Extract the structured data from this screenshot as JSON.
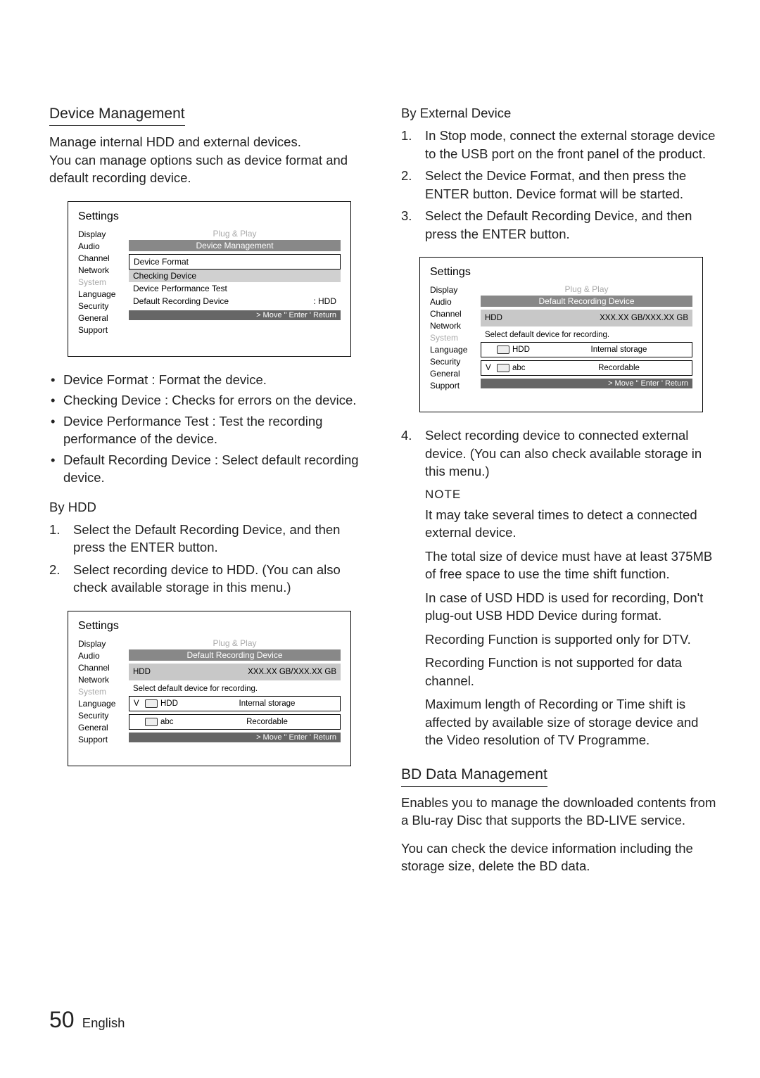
{
  "left": {
    "section_title": "Device Management",
    "intro_p1": "Manage internal HDD and external devices.",
    "intro_p2": "You can manage options such as device format and default recording device.",
    "ui1": {
      "title": "Settings",
      "sidebar": [
        "Display",
        "Audio",
        "Channel",
        "Network",
        "System",
        "Language",
        "Security",
        "General",
        "Support"
      ],
      "plug": "Plug & Play",
      "header": "Device Management",
      "rows": [
        {
          "label": "Device Format",
          "value": "",
          "boxed": true
        },
        {
          "label": "Checking Device",
          "value": "",
          "hi": true
        },
        {
          "label": "Device Performance Test",
          "value": ""
        },
        {
          "label": "Default Recording Device",
          "value": ": HDD"
        }
      ],
      "footer": "> Move    \" Enter    ' Return"
    },
    "bullets": [
      "Device Format : Format the device.",
      "Checking Device : Checks for errors on the device.",
      "Device Performance Test : Test the recording performance of the device.",
      "Default Recording Device : Select default recording device."
    ],
    "by_hdd_heading": "By HDD",
    "by_hdd_steps": [
      "Select the Default Recording Device, and then press the ENTER button.",
      "Select recording device to HDD. (You can also check available storage in this menu.)"
    ],
    "ui2": {
      "title": "Settings",
      "sidebar": [
        "Display",
        "Audio",
        "Channel",
        "Network",
        "System",
        "Language",
        "Security",
        "General",
        "Support"
      ],
      "plug": "Plug & Play",
      "header": "Default Recording Device",
      "hdd_label": "HDD",
      "hdd_value": "XXX.XX GB/XXX.XX GB",
      "select_text": "Select default device for recording.",
      "choice1_pre": "V",
      "choice1_label": "HDD",
      "choice1_value": "Internal storage",
      "choice2_pre": "",
      "choice2_label": "abc",
      "choice2_value": "Recordable",
      "footer": "> Move    \" Enter    ' Return"
    }
  },
  "right": {
    "by_ext_heading": "By External Device",
    "by_ext_steps": [
      "In Stop mode, connect the external storage device to the USB port on the front panel of the product.",
      "Select the Device Format, and then press the ENTER button. Device format will be started.",
      "Select the Default Recording Device, and then press the ENTER button."
    ],
    "ui3": {
      "title": "Settings",
      "sidebar": [
        "Display",
        "Audio",
        "Channel",
        "Network",
        "System",
        "Language",
        "Security",
        "General",
        "Support"
      ],
      "plug": "Plug & Play",
      "header": "Default Recording Device",
      "hdd_label": "HDD",
      "hdd_value": "XXX.XX GB/XXX.XX GB",
      "select_text": "Select default device for recording.",
      "choice1_pre": "",
      "choice1_label": "HDD",
      "choice1_value": "Internal storage",
      "choice2_pre": "V",
      "choice2_label": "abc",
      "choice2_value": "Recordable",
      "footer": "> Move    \" Enter    ' Return"
    },
    "step4": "Select recording device to connected external device. (You can also check available storage in this menu.)",
    "note_label": "NOTE",
    "notes": [
      "It may take several times to detect a connected external device.",
      "The total size of device must have at least 375MB of free space to use the time shift function.",
      "In case of USD HDD is used for recording, Don't plug-out USB HDD Device during format.",
      "Recording Function is supported only for DTV.",
      "Recording Function is not supported for data channel.",
      "Maximum length of Recording or Time shift is affected by available size of storage device and the Video resolution of TV Programme."
    ],
    "bd_title": "BD Data Management",
    "bd_p1": "Enables you to manage the downloaded contents from a Blu-ray Disc that supports the BD-LIVE service.",
    "bd_p2": "You can check the device information including the storage size, delete the BD data."
  },
  "footer": {
    "page": "50",
    "lang": "English"
  }
}
